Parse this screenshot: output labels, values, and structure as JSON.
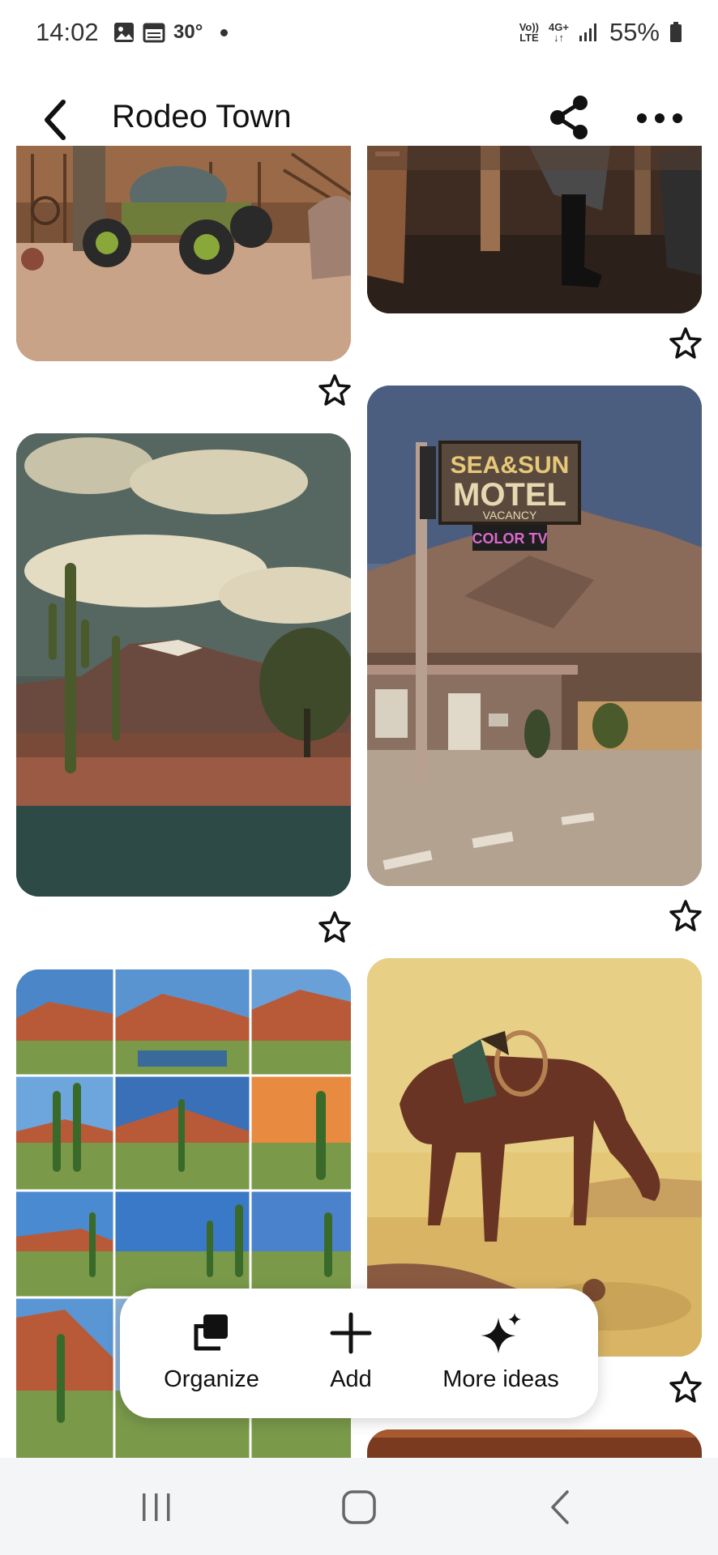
{
  "status_bar": {
    "time": "14:02",
    "temperature": "30°",
    "network_top": "Vo))",
    "network_bottom": "LTE",
    "signal_top": "4G+",
    "battery": "55%"
  },
  "header": {
    "title": "Rodeo Town",
    "back_icon": "arrow-left-icon",
    "share_icon": "share-icon",
    "more_icon": "more-horizontal-icon"
  },
  "pins": [
    {
      "name": "pin-old-tractor",
      "subject": "vintage tractor outside wooden western storefront"
    },
    {
      "name": "pin-cowboy-boots",
      "subject": "cowboy boots by wooden barrel"
    },
    {
      "name": "pin-desert-saguaro",
      "subject": "saguaro cactus desert with reflecting pond"
    },
    {
      "name": "pin-sea-sun-motel",
      "subject": "motel sign in desert",
      "sign_line1": "SEA&SUN",
      "sign_line2": "MOTEL",
      "sign_line3": "VACANCY",
      "sign_line4": "COLOR TV"
    },
    {
      "name": "pin-desert-collage",
      "subject": "grid of desert cactus landscapes"
    },
    {
      "name": "pin-horse-drinking",
      "subject": "horse drinking water in desert illustration"
    }
  ],
  "action_bar": {
    "organize": "Organize",
    "add": "Add",
    "more_ideas": "More ideas"
  },
  "colors": {
    "accent": "#111111",
    "background": "#ffffff",
    "navbar": "#f4f5f7"
  }
}
